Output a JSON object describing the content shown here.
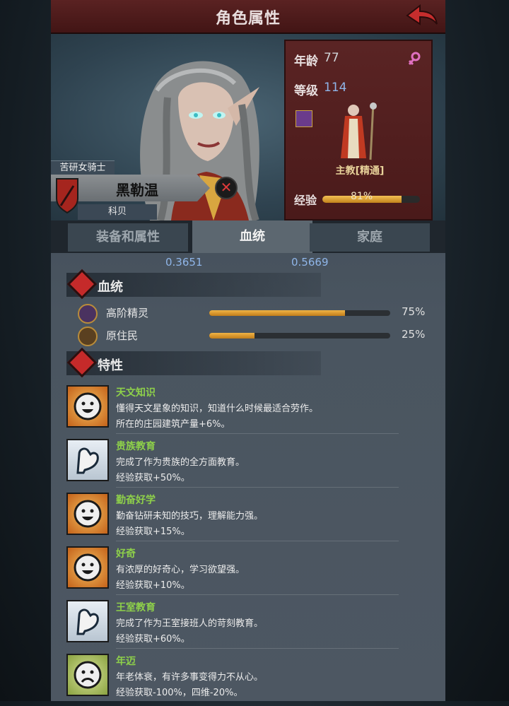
{
  "header": {
    "title": "角色属性"
  },
  "character": {
    "rank_title": "苦研女骑士",
    "name": "黑勒温",
    "surname": "科贝",
    "age_label": "年龄",
    "age": "77",
    "level_label": "等级",
    "level": "114",
    "class_name": "主教[精通]",
    "xp_label": "经验",
    "xp_percent_text": "81%",
    "xp_fraction": 0.81
  },
  "tabs": [
    {
      "label": "装备和属性"
    },
    {
      "label": "血统"
    },
    {
      "label": "家庭"
    }
  ],
  "stats": {
    "left": "0.3651",
    "right": "0.5669"
  },
  "lineage": {
    "title": "血统",
    "items": [
      {
        "name": "高阶精灵",
        "percent_text": "75%",
        "fraction": 0.75
      },
      {
        "name": "原住民",
        "percent_text": "25%",
        "fraction": 0.25
      }
    ]
  },
  "traits": {
    "title": "特性",
    "items": [
      {
        "name": "天文知识",
        "desc": "懂得天文星象的知识，知道什么时候最适合劳作。",
        "effect": "所在的庄园建筑产量+6%。",
        "icon": "smile-face-icon"
      },
      {
        "name": "贵族教育",
        "desc": "完成了作为贵族的全方面教育。",
        "effect": "经验获取+50%。",
        "icon": "flexed-arm-icon"
      },
      {
        "name": "勤奋好学",
        "desc": "勤奋钻研未知的技巧，理解能力强。",
        "effect": "经验获取+15%。",
        "icon": "smile-face-icon"
      },
      {
        "name": "好奇",
        "desc": "有浓厚的好奇心，学习欲望强。",
        "effect": "经验获取+10%。",
        "icon": "smile-face-icon"
      },
      {
        "name": "王室教育",
        "desc": "完成了作为王室接班人的苛刻教育。",
        "effect": "经验获取+60%。",
        "icon": "flexed-arm-icon"
      },
      {
        "name": "年迈",
        "desc": "年老体衰，有许多事变得力不从心。",
        "effect": "经验获取-100%，四维-20%。",
        "icon": "sad-face-icon"
      }
    ]
  },
  "colors": {
    "header_bg": "#4e1c1c",
    "trait_name": "#8ed04a",
    "value_blue": "#8fb5e8",
    "bar_gold": "#e8a83a"
  }
}
